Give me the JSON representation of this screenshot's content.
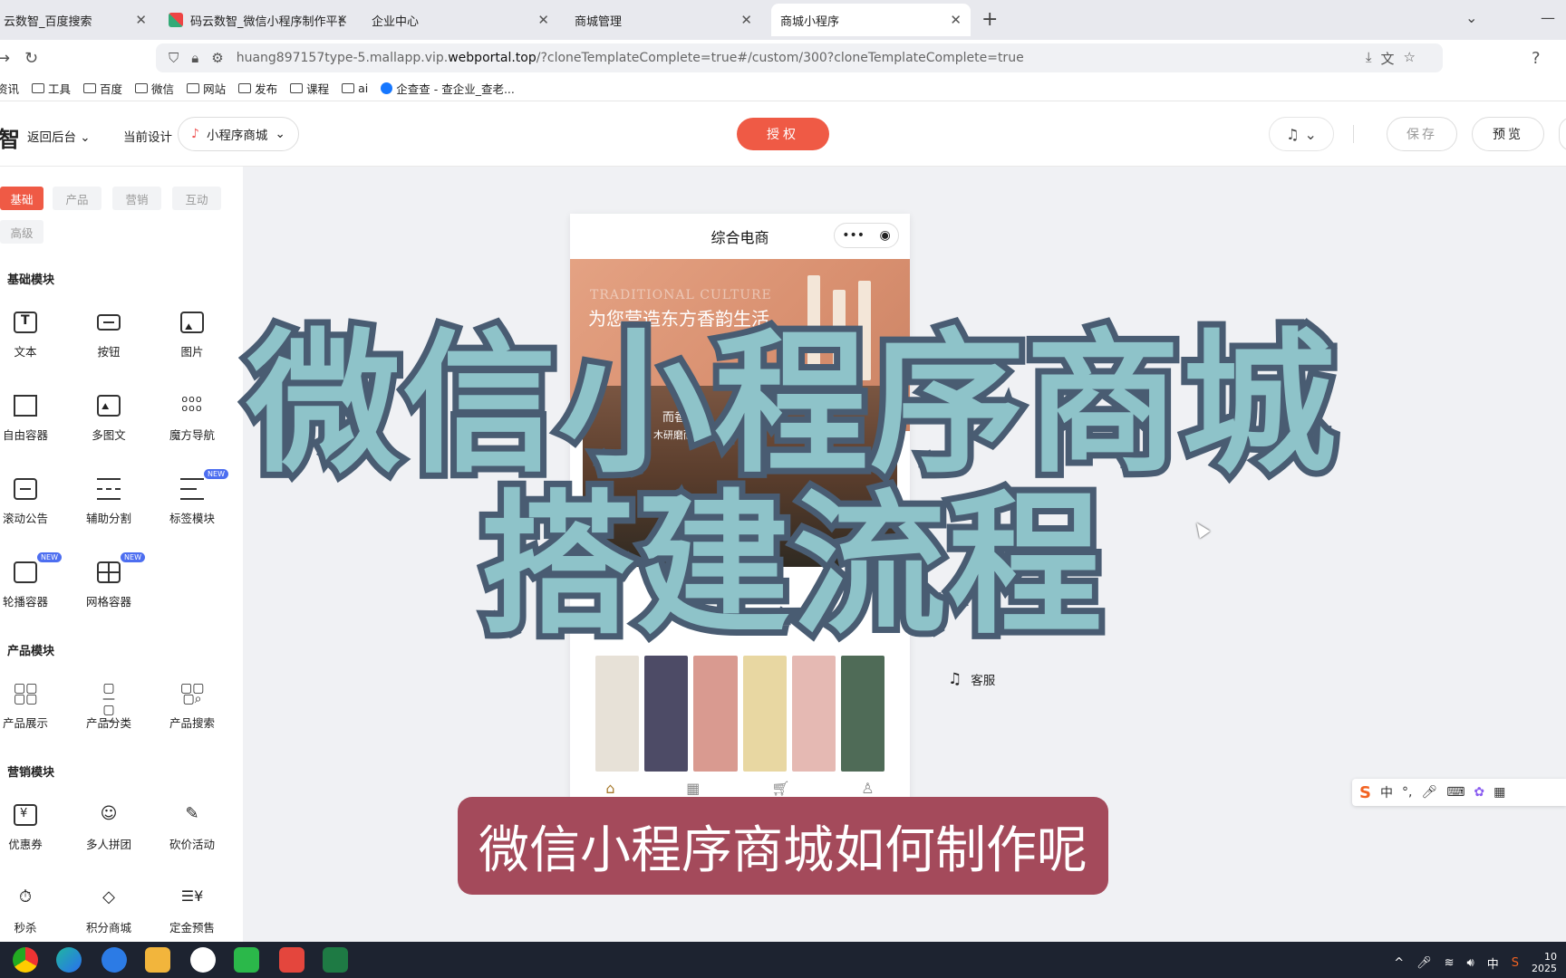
{
  "browser": {
    "tabs": [
      {
        "label": "云数智_百度搜索"
      },
      {
        "label": "码云数智_微信小程序制作平台_"
      },
      {
        "label": "企业中心"
      },
      {
        "label": "商城管理"
      },
      {
        "label": "商城小程序"
      }
    ],
    "url_prefix": "huang897157type-5.mallapp.vip.",
    "url_domain": "webportal.top",
    "url_suffix": "/?cloneTemplateComplete=true#/custom/300?cloneTemplateComplete=true",
    "bookmarks": [
      "资讯",
      "工具",
      "百度",
      "微信",
      "网站",
      "发布",
      "课程",
      "ai",
      "企查查 - 查企业_查老..."
    ]
  },
  "header": {
    "logo": "智",
    "back_label": "返回后台",
    "current_design_label": "当前设计",
    "design_select": "小程序商城",
    "auth_label": "授权",
    "save_label": "保存",
    "preview_label": "预览"
  },
  "left_panel": {
    "tabs": [
      "基础",
      "产品",
      "营销",
      "互动",
      "高级"
    ],
    "sections": {
      "basic": "基础模块",
      "product": "产品模块",
      "marketing": "营销模块"
    },
    "basic_items": [
      "文本",
      "按钮",
      "图片",
      "自由容器",
      "多图文",
      "魔方导航",
      "滚动公告",
      "辅助分割",
      "标签模块",
      "轮播容器",
      "网格容器"
    ],
    "product_items": [
      "产品展示",
      "产品分类",
      "产品搜索"
    ],
    "marketing_items": [
      "优惠券",
      "多人拼团",
      "砍价活动",
      "秒杀",
      "积分商城",
      "定金预售"
    ],
    "new_badge": "NEW"
  },
  "phone": {
    "title": "综合电商",
    "banner_en": "TRADITIONAL CULTURE",
    "banner_zh": "为您营造东方香韵生活",
    "banner2_t1": "而香",
    "banner2_t2": "木研磨而成"
  },
  "service_label": "客服",
  "overlay": {
    "title_line1": "微信小程序商城",
    "title_line2": "搭建流程",
    "subtitle": "微信小程序商城如何制作呢"
  },
  "ime": {
    "lang": "中"
  },
  "tray": {
    "lang": "中",
    "year": "2025",
    "hour": "10"
  },
  "colors": {
    "accent": "#ef5a45",
    "title_fill": "#8ec3c9",
    "title_stroke": "#495c72",
    "subtitle_bg": "#a44a5b"
  }
}
